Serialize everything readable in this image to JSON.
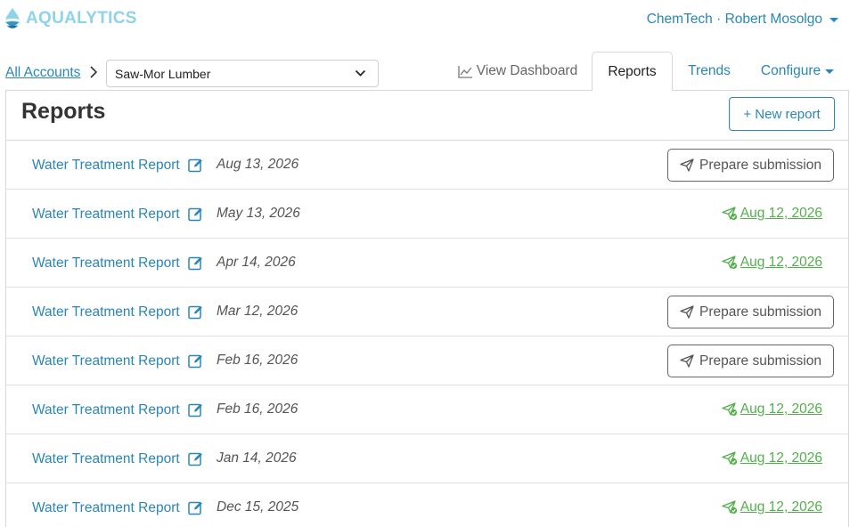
{
  "app": {
    "name": "AQUALYTICS",
    "brand_color": "#8fd3ea",
    "accent_color": "#2a86b8",
    "success_color": "#52b04a"
  },
  "user_menu": {
    "label": "ChemTech · Robert Mosolgo"
  },
  "breadcrumb": {
    "root": "All Accounts",
    "selected_account": "Saw-Mor Lumber"
  },
  "tabs": {
    "dashboard": "View Dashboard",
    "reports": "Reports",
    "trends": "Trends",
    "configure": "Configure"
  },
  "page": {
    "title": "Reports",
    "new_report_label": "+ New report"
  },
  "reports": [
    {
      "name": "Water Treatment Report",
      "date": "Aug 13, 2026",
      "status": "prepare",
      "action": "Prepare submission"
    },
    {
      "name": "Water Treatment Report",
      "date": "May 13, 2026",
      "status": "submitted",
      "action": "Aug 12, 2026"
    },
    {
      "name": "Water Treatment Report",
      "date": "Apr 14, 2026",
      "status": "submitted",
      "action": "Aug 12, 2026"
    },
    {
      "name": "Water Treatment Report",
      "date": "Mar 12, 2026",
      "status": "prepare",
      "action": "Prepare submission"
    },
    {
      "name": "Water Treatment Report",
      "date": "Feb 16, 2026",
      "status": "prepare",
      "action": "Prepare submission"
    },
    {
      "name": "Water Treatment Report",
      "date": "Feb 16, 2026",
      "status": "submitted",
      "action": "Aug 12, 2026"
    },
    {
      "name": "Water Treatment Report",
      "date": "Jan 14, 2026",
      "status": "submitted",
      "action": "Aug 12, 2026"
    },
    {
      "name": "Water Treatment Report",
      "date": "Dec 15, 2025",
      "status": "submitted",
      "action": "Aug 12, 2026"
    }
  ]
}
